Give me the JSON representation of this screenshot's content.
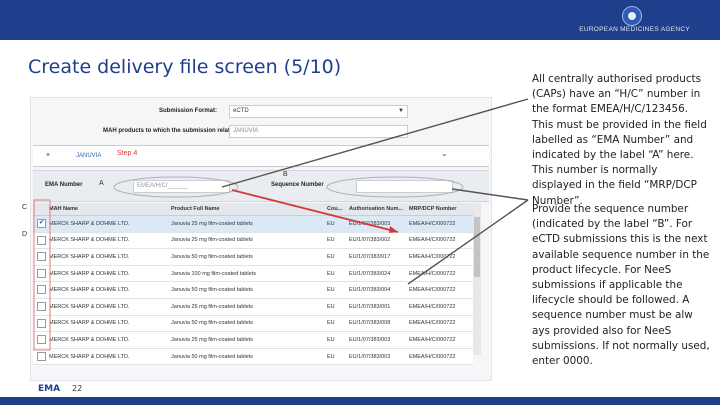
{
  "header": {
    "agency": "EUROPEAN MEDICINES AGENCY"
  },
  "slide": {
    "title": "Create delivery file screen (5/10)",
    "page_number": "22",
    "footer_logo": "EMA"
  },
  "notes": [
    "All centrally authorised products (CAPs) have an “H/C” number in the format EMEA/H/C/123456. This must be provided in the field labelled as “EMA Number” and indicated by the label “A” here. This number is normally displayed in the field “MRP/DCP Number”.",
    "Provide the sequence number (indicated by the label “B”. For eCTD submissions this is the next available sequence number in the product lifecycle. For NeeS submissions if applicable the lifecycle should be followed. A sequence number must be alw ays provided also for NeeS submissions. If not normally used, enter 0000."
  ],
  "app": {
    "submission_format_label": "Submission Format:",
    "submission_format_value": "eCTD",
    "mah_products_label": "MAH products to which the submission relates:",
    "mah_products_value": "JANUVIA",
    "step_close": "×",
    "step_product": "JANUVIA",
    "step_label": "Step 4",
    "step_toggle": "⌄",
    "ema_number_label": "EMA Number",
    "ema_number_placeholder": "EMEA/H/C/______",
    "sequence_number_label": "Sequence Number",
    "labels": {
      "A": "A",
      "B": "B",
      "C": "C",
      "D": "D"
    },
    "table": {
      "columns": [
        "MAH Name",
        "Product Full Name",
        "Cou...",
        "Authorisation Num...",
        "MRP/DCP Number"
      ],
      "rows": [
        [
          "MERCK SHARP & DOHME LTD.",
          "Januvia 25 mg film-coated tablets",
          "EU",
          "EU/1/07/383/003",
          "EMEA/H/C/000722",
          true
        ],
        [
          "MERCK SHARP & DOHME LTD.",
          "Januvia 25 mg film-coated tablets",
          "EU",
          "EU/1/07/383/002",
          "EMEA/H/C/000722",
          false
        ],
        [
          "MERCK SHARP & DOHME LTD.",
          "Januvia 50 mg film-coated tablets",
          "EU",
          "EU/1/07/383/017",
          "EMEA/H/C/000722",
          false
        ],
        [
          "MERCK SHARP & DOHME LTD.",
          "Januvia 100 mg film-coated tablets",
          "EU",
          "EU/1/07/383/024",
          "EMEA/H/C/000722",
          false
        ],
        [
          "MERCK SHARP & DOHME LTD.",
          "Januvia 50 mg film-coated tablets",
          "EU",
          "EU/1/07/383/004",
          "EMEA/H/C/000722",
          false
        ],
        [
          "MERCK SHARP & DOHME LTD.",
          "Januvia 25 mg film-coated tablets",
          "EU",
          "EU/1/07/383/001",
          "EMEA/H/C/000722",
          false
        ],
        [
          "MERCK SHARP & DOHME LTD.",
          "Januvia 50 mg film-coated tablets",
          "EU",
          "EU/1/07/383/008",
          "EMEA/H/C/000722",
          false
        ],
        [
          "MERCK SHARP & DOHME LTD.",
          "Januvia 25 mg film-coated tablets",
          "EU",
          "EU/1/07/383/003",
          "EMEA/H/C/000722",
          false
        ],
        [
          "MERCK SHARP & DOHME LTD.",
          "Januvia 50 mg film-coated tablets",
          "EU",
          "EU/1/07/383/003",
          "EMEA/H/C/000722",
          false
        ]
      ]
    }
  },
  "colors": {
    "brand": "#1f3f8c",
    "annotation_red": "#d23a3a",
    "accent_step": "#d23a3a"
  }
}
